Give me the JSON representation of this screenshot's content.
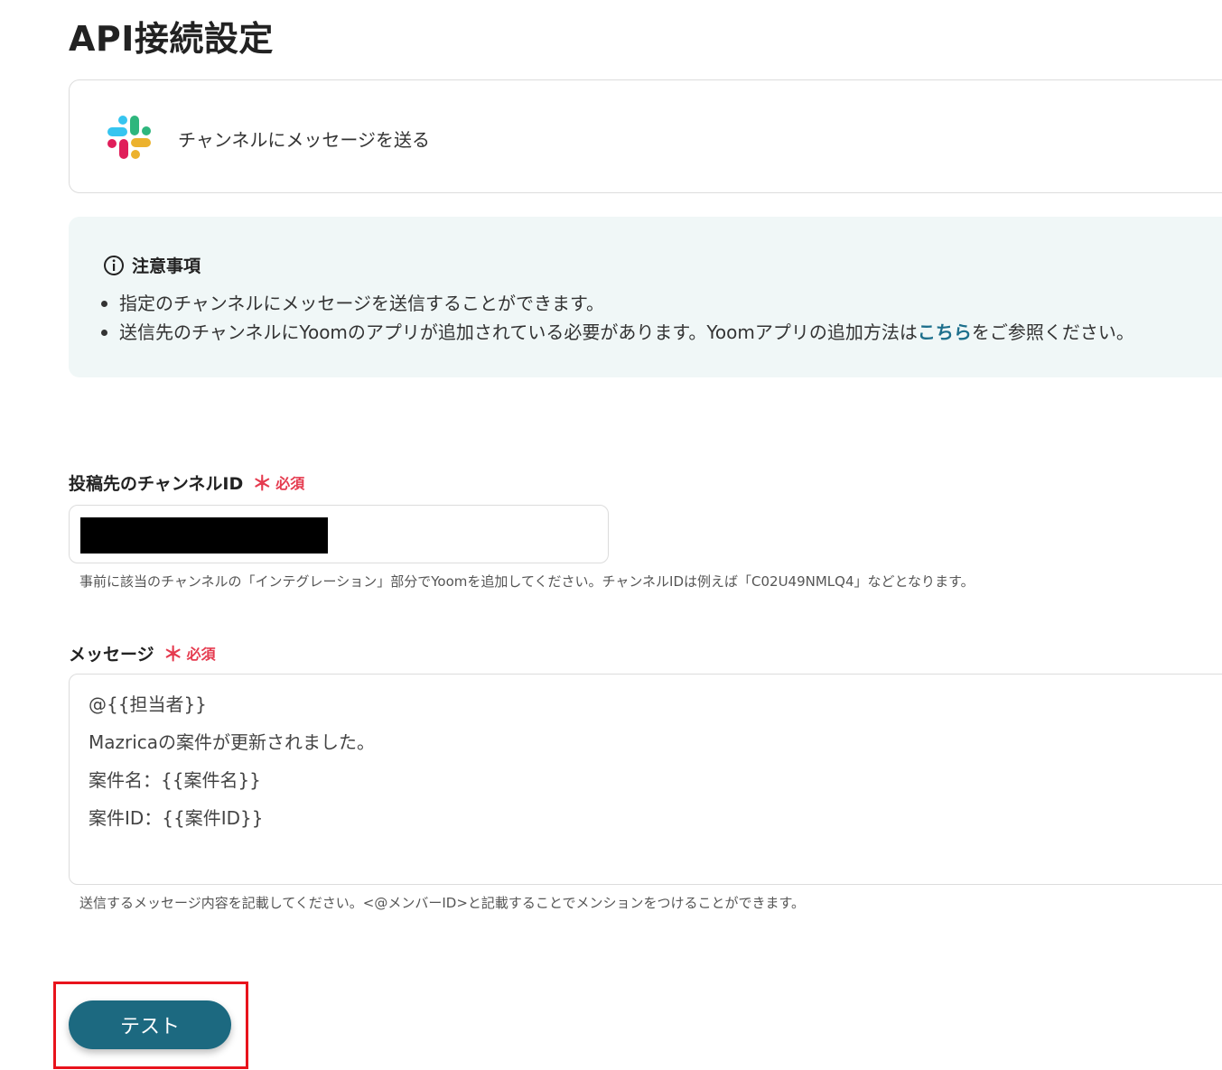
{
  "page": {
    "title": "API接続設定"
  },
  "action": {
    "label": "チャンネルにメッセージを送る",
    "icon": "slack-icon"
  },
  "notice": {
    "title": "注意事項",
    "items": [
      {
        "text": "指定のチャンネルにメッセージを送信することができます。"
      },
      {
        "text_before": "送信先のチャンネルにYoomのアプリが追加されている必要があります。Yoomアプリの追加方法は",
        "link": "こちら",
        "text_after": "をご参照ください。"
      }
    ]
  },
  "channel_field": {
    "label": "投稿先のチャンネルID",
    "required_mark": "＊",
    "required_text": "必須",
    "hint": "事前に該当のチャンネルの「インテグレーション」部分でYoomを追加してください。チャンネルIDは例えば「C02U49NMLQ4」などとなります。"
  },
  "message_field": {
    "label": "メッセージ",
    "required_mark": "＊",
    "required_text": "必須",
    "lines": [
      "@{{担当者}}",
      "Mazricaの案件が更新されました。",
      "案件名：{{案件名}}",
      "案件ID：{{案件ID}}"
    ],
    "hint": "送信するメッセージ内容を記載してください。<@メンバーID>と記載することでメンションをつけることができます。"
  },
  "test_button": {
    "label": "テスト"
  },
  "colors": {
    "accent": "#1c6980",
    "link": "#1d6f8c",
    "required": "#e53b4f",
    "highlight": "#e8131c",
    "notice_bg": "#f0f7f7"
  }
}
